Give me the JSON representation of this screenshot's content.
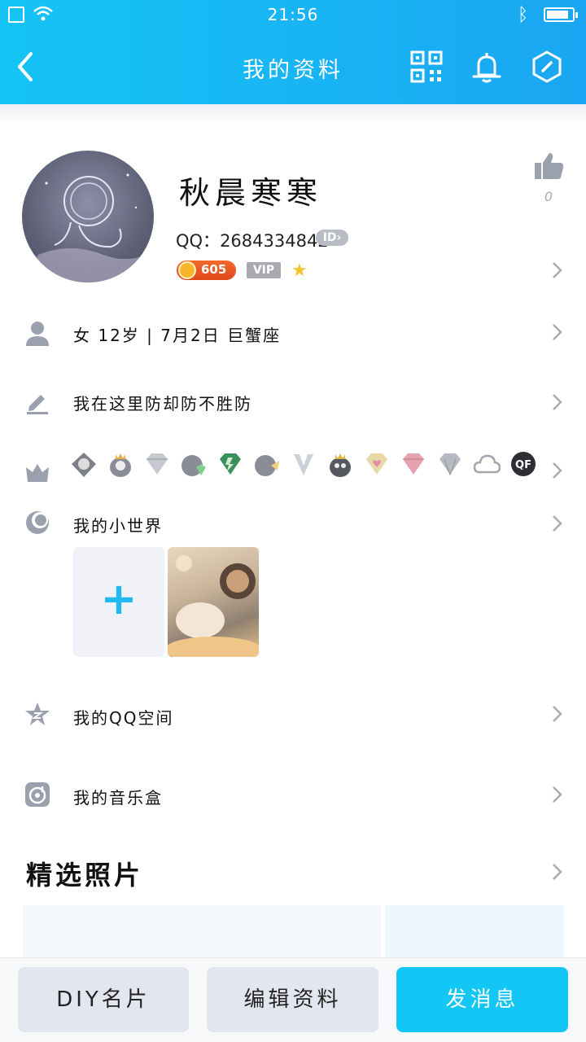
{
  "status_bar": {
    "time": "21:56"
  },
  "nav": {
    "title": "我的资料"
  },
  "profile": {
    "nickname": "秋晨寒寒",
    "qq_label": "QQ：",
    "qq_number": "2684334842",
    "id_badge": "ID",
    "coins": "605",
    "vip": "VIP",
    "likes": "0"
  },
  "info_rows": {
    "basic": "女  12岁 | 7月2日  巨蟹座",
    "signature": "我在这里防却防不胜防",
    "world": "我的小世界",
    "qzone": "我的QQ空间",
    "music": "我的音乐盒"
  },
  "badges": [
    "penguin-wing",
    "penguin-crown",
    "diamond",
    "penguin-diamond",
    "green-diamond",
    "penguin-pen",
    "v-tie",
    "penguin-black-crown",
    "heart-diamond",
    "pink-diamond",
    "grey-diamond",
    "cloud",
    "qf-logo"
  ],
  "featured": {
    "title": "精选照片"
  },
  "actions": {
    "diy_card": "DIY名片",
    "edit_profile": "编辑资料",
    "send_message": "发消息"
  },
  "colors": {
    "header": "#18b5f4",
    "accent": "#12c6f6",
    "icon_grey": "#9aa0ad"
  }
}
